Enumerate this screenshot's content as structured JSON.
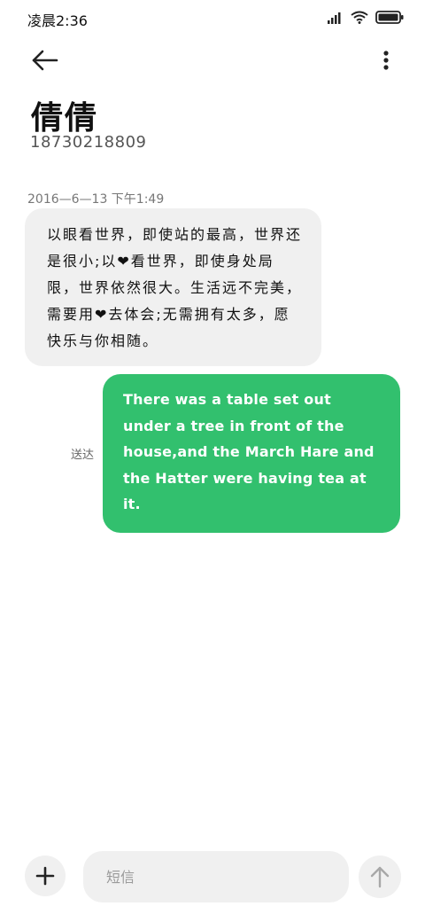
{
  "status_bar": {
    "time": "凌晨2:36",
    "icons": [
      "signal-icon",
      "wifi-icon",
      "battery-icon"
    ]
  },
  "header": {
    "back_icon": "back-arrow-icon",
    "more_icon": "more-vertical-icon"
  },
  "contact": {
    "name": "倩倩",
    "number": "18730218809"
  },
  "messages": [
    {
      "direction": "incoming",
      "date": "2016—6—13 下午1:49",
      "text": "以眼看世界，即使站的最高，世界还是很小;以❤看世界，即使身处局限，世界依然很大。生活远不完美，需要用❤去体会;无需拥有太多，愿快乐与你相随。"
    },
    {
      "direction": "outgoing",
      "status": "送达",
      "text": "There was a table set out under a tree in front of the house,and the March Hare and the Hatter were having tea at it."
    }
  ],
  "composer": {
    "add_icon": "plus-icon",
    "placeholder": "短信",
    "send_icon": "send-arrow-icon"
  },
  "colors": {
    "outgoing_bubble": "#32c06e",
    "incoming_bubble": "#f0f0f0",
    "background": "#ffffff"
  }
}
